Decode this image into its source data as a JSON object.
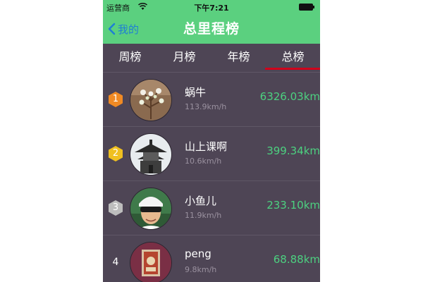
{
  "status_bar": {
    "carrier": "运营商",
    "time": "下午7:21"
  },
  "nav": {
    "back_label": "我的",
    "title": "总里程榜"
  },
  "tabs": [
    {
      "label": "周榜",
      "selected": false
    },
    {
      "label": "月榜",
      "selected": false
    },
    {
      "label": "年榜",
      "selected": false
    },
    {
      "label": "总榜",
      "selected": true
    }
  ],
  "ranking": [
    {
      "rank": "1",
      "badge_color": "#f08a24",
      "name": "蜗牛",
      "speed": "113.9km/h",
      "distance": "6326.03km"
    },
    {
      "rank": "2",
      "badge_color": "#f0c020",
      "name": "山上课啊",
      "speed": "10.6km/h",
      "distance": "399.34km"
    },
    {
      "rank": "3",
      "badge_color": "#bdbdbd",
      "name": "小鱼儿",
      "speed": "11.9km/h",
      "distance": "233.10km"
    },
    {
      "rank": "4",
      "badge_color": "",
      "name": "peng",
      "speed": "9.8km/h",
      "distance": "68.88km"
    }
  ],
  "colors": {
    "accent": "#5bd07f",
    "background": "#4e4555",
    "distance": "#4cd180",
    "tab_underline": "#d0021b"
  }
}
